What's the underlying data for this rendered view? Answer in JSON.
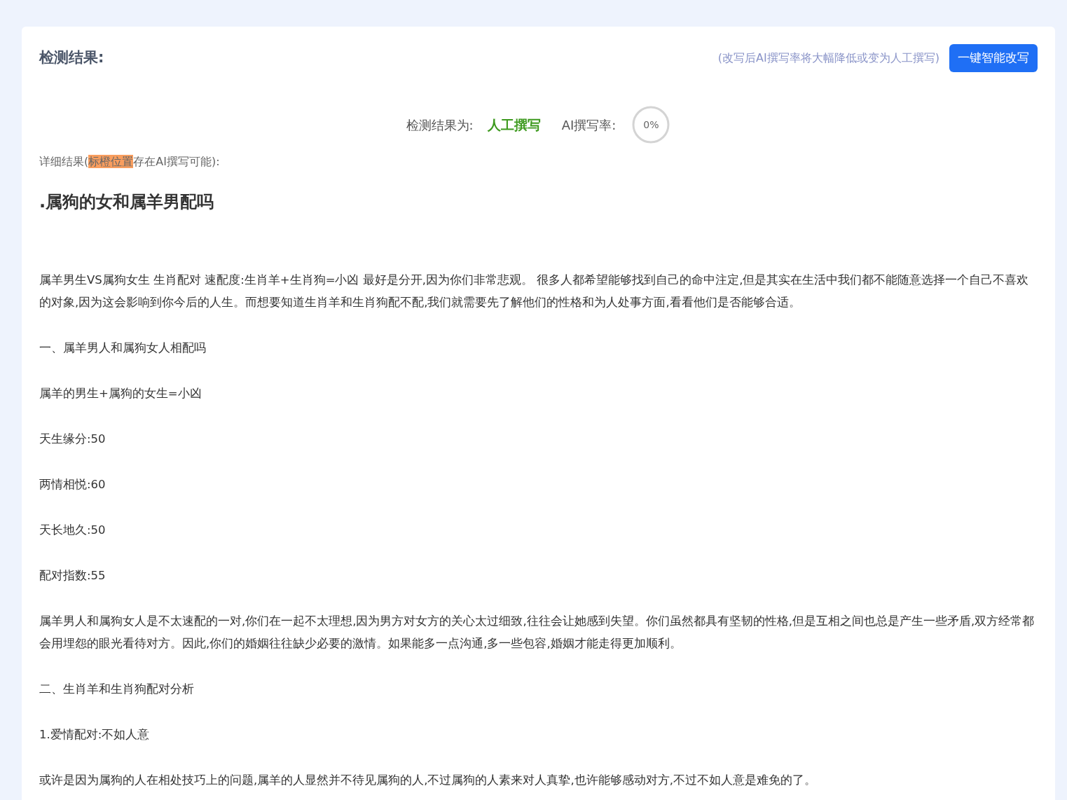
{
  "header": {
    "title": "检测结果:",
    "hint": "(改写后AI撰写率将大幅降低或变为人工撰写)",
    "button": "一键智能改写"
  },
  "result": {
    "label": "检测结果为:",
    "verdict": "人工撰写",
    "rate_label": "AI撰写率:",
    "rate": "0%",
    "level": 0
  },
  "detail": {
    "before": "详细结果(",
    "highlight": "标橙位置",
    "after": "存在AI撰写可能):"
  },
  "article": {
    "title": ".属狗的女和属羊男配吗",
    "paragraphs": [
      "属羊男生VS属狗女生 生肖配对 速配度:生肖羊+生肖狗=小凶 最好是分开,因为你们非常悲观。 很多人都希望能够找到自己的命中注定,但是其实在生活中我们都不能随意选择一个自己不喜欢的对象,因为这会影响到你今后的人生。而想要知道生肖羊和生肖狗配不配,我们就需要先了解他们的性格和为人处事方面,看看他们是否能够合适。",
      "一、属羊男人和属狗女人相配吗",
      "属羊的男生+属狗的女生=小凶",
      "天生缘分:50",
      "两情相悦:60",
      "天长地久:50",
      "配对指数:55",
      "属羊男人和属狗女人是不太速配的一对,你们在一起不太理想,因为男方对女方的关心太过细致,往往会让她感到失望。你们虽然都具有坚韧的性格,但是互相之间也总是产生一些矛盾,双方经常都会用埋怨的眼光看待对方。因此,你们的婚姻往往缺少必要的激情。如果能多一点沟通,多一些包容,婚姻才能走得更加顺利。",
      "二、生肖羊和生肖狗配对分析",
      "1.爱情配对:不如人意",
      "或许是因为属狗的人在相处技巧上的问题,属羊的人显然并不待见属狗的人,不过属狗的人素来对人真挚,也许能够感动对方,不过不如人意是难免的了。"
    ]
  }
}
